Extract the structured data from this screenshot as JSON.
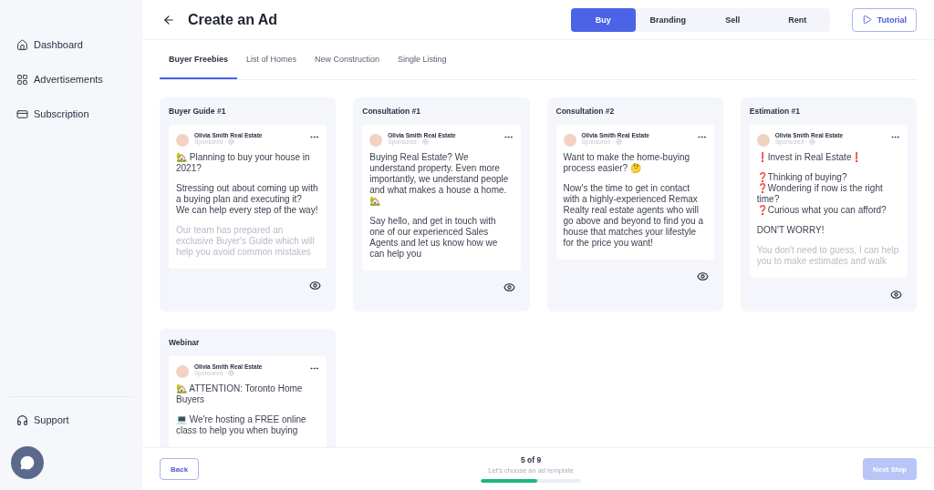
{
  "sidebar": {
    "items": [
      {
        "kind": "home",
        "label": "Dashboard"
      },
      {
        "kind": "grid",
        "label": "Advertisements"
      },
      {
        "kind": "card",
        "label": "Subscription"
      }
    ],
    "support": {
      "label": "Support"
    }
  },
  "header": {
    "title": "Create an Ad",
    "modes": [
      {
        "label": "Buy",
        "selected": true
      },
      {
        "label": "Branding",
        "selected": false
      },
      {
        "label": "Sell",
        "selected": false
      },
      {
        "label": "Rent",
        "selected": false
      }
    ],
    "tutorial": "Tutorial"
  },
  "tabs": [
    {
      "label": "Buyer Freebies",
      "selected": true
    },
    {
      "label": "List of Homes",
      "selected": false
    },
    {
      "label": "New Construction",
      "selected": false
    },
    {
      "label": "Single Listing",
      "selected": false
    }
  ],
  "templates": [
    {
      "title": "Buyer Guide #1",
      "author": "Olivia Smith Real Estate",
      "meta": "Sponsored ·",
      "body": [
        "🏡 Planning to buy your house in 2021?",
        "Stressing out about coming up with a buying plan and executing it?\nWe can help every step of the way!",
        "Our team has prepared an exclusive Buyer's Guide which will help you avoid common mistakes"
      ]
    },
    {
      "title": "Consultation #1",
      "author": "Olivia Smith Real Estate",
      "meta": "Sponsored ·",
      "body": [
        "Buying Real Estate? We understand property. Even more importantly, we understand people and what makes a house a home. 🏡",
        "Say hello, and get in touch with one of our experienced Sales Agents and let us know how we can help you"
      ]
    },
    {
      "title": "Consultation #2",
      "author": "Olivia Smith Real Estate",
      "meta": "Sponsored ·",
      "body": [
        "Want to make the home-buying process easier? 🤔",
        "Now's the time to get in contact with a highly-experienced Remax Realty real estate agents who will go above and beyond to find you a house that matches your lifestyle for the price you want!"
      ]
    },
    {
      "title": "Estimation #1",
      "author": "Olivia Smith Real Estate",
      "meta": "Sponsored ·",
      "body": [
        "❗Invest in Real Estate❗",
        "❓Thinking of buying?\n❓Wondering if now is the right time?\n❓Curious what you can afford?",
        "DON'T WORRY!",
        "You don't need to guess, I can help you to make estimates and walk"
      ]
    },
    {
      "title": "Webinar",
      "author": "Olivia Smith Real Estate",
      "meta": "Sponsored ·",
      "body": [
        "🏡 ATTENTION: Toronto Home Buyers",
        "💻 We're hosting a FREE online class to help you when buying"
      ],
      "clipped": true
    }
  ],
  "footer": {
    "back": "Back",
    "step": "5 of 9",
    "hint": "Let's choose an ad template",
    "level": 0.56,
    "next": {
      "label": "Next Step",
      "disabled": true
    }
  }
}
